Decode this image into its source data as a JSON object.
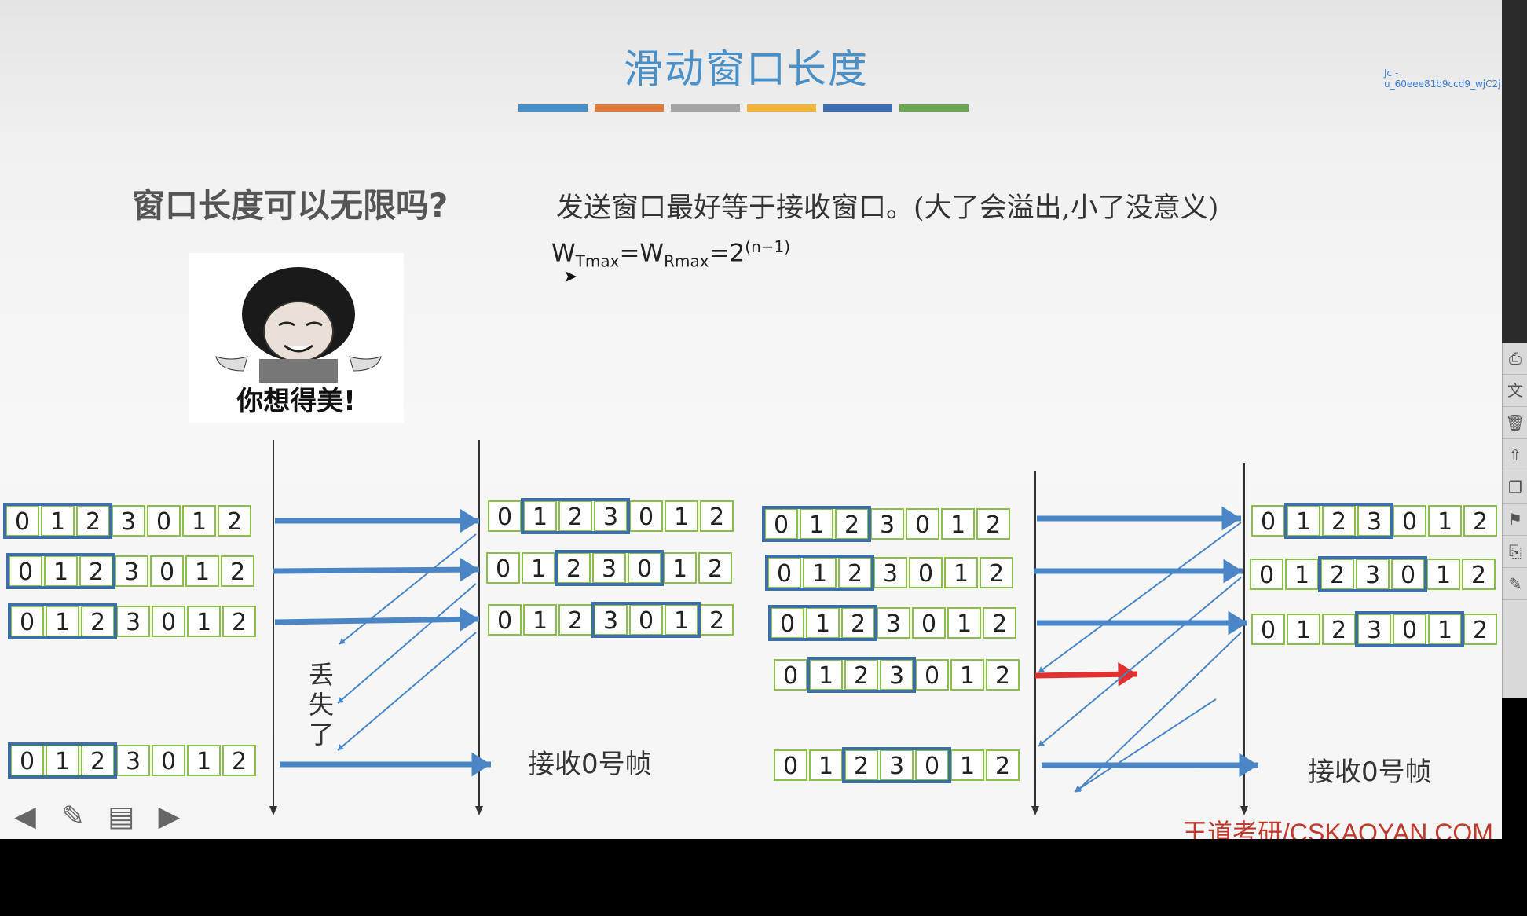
{
  "slide": {
    "title": "滑动窗口长度",
    "color_bar": [
      "#4a90c8",
      "#e07b39",
      "#a5a5a5",
      "#f2b53c",
      "#3d6db5",
      "#6aa84f"
    ],
    "question": "窗口长度可以无限吗?",
    "answer": "发送窗口最好等于接收窗口。(大了会溢出,小了没意义)",
    "formula": {
      "w1": "W",
      "sub1": "Tmax",
      "eq1": "=W",
      "sub2": "Rmax",
      "eq2": "=2",
      "sup": "(n−1)"
    },
    "meme_caption": "你想得美!",
    "lost_label": "丢失了",
    "receive_left": "接收0号帧",
    "receive_right": "接收0号帧",
    "watermark": "王道考研/CSKAOYAN.COM",
    "user_tag": "Jc - u_60eee81b9ccd9_wjC2j"
  },
  "diagram": {
    "sequence": [
      "0",
      "1",
      "2",
      "3",
      "0",
      "1",
      "2"
    ],
    "frame_color": "#8bbf4a",
    "window_color": "#3c6fa8",
    "arrow_color": "#4a86c5",
    "lost_arrow_color": "#e03030",
    "left_sender_windows": [
      [
        0,
        1,
        2
      ],
      [
        0,
        1,
        2
      ],
      [
        0,
        1,
        2
      ],
      [
        0,
        1,
        2
      ]
    ],
    "left_receiver_windows": [
      [
        1,
        2,
        3
      ],
      [
        2,
        3,
        4
      ],
      [
        3,
        4,
        5
      ]
    ],
    "right_sender_windows": [
      [
        0,
        1,
        2
      ],
      [
        0,
        1,
        2
      ],
      [
        0,
        1,
        2
      ],
      [
        1,
        2,
        3
      ],
      [
        2,
        3,
        4
      ]
    ],
    "right_receiver_windows": [
      [
        1,
        2,
        3
      ],
      [
        2,
        3,
        4
      ],
      [
        3,
        4,
        5
      ]
    ]
  },
  "nav": {
    "icons": [
      "arrow-left-icon",
      "pen-icon",
      "notes-icon",
      "arrow-right-icon"
    ]
  },
  "side_panel": {
    "items": [
      "文"
    ]
  }
}
